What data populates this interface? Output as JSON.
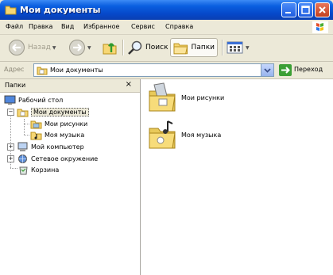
{
  "window": {
    "title": "Мои документы"
  },
  "menu": [
    "Файл",
    "Правка",
    "Вид",
    "Избранное",
    "Сервис",
    "Справка"
  ],
  "toolbar": {
    "back_label": "Назад",
    "search_label": "Поиск",
    "folders_label": "Папки"
  },
  "address": {
    "label": "Адрес",
    "value": "Мои документы",
    "go_label": "Переход"
  },
  "folders_pane": {
    "title": "Папки",
    "tree": [
      {
        "label": "Рабочий стол"
      },
      {
        "label": "Мои документы"
      },
      {
        "label": "Мои рисунки"
      },
      {
        "label": "Моя музыка"
      },
      {
        "label": "Мой компьютер"
      },
      {
        "label": "Сетевое окружение"
      },
      {
        "label": "Корзина"
      }
    ]
  },
  "content": {
    "items": [
      {
        "label": "Мои рисунки",
        "icon": "pictures-folder-icon"
      },
      {
        "label": "Моя музыка",
        "icon": "music-folder-icon"
      }
    ]
  }
}
